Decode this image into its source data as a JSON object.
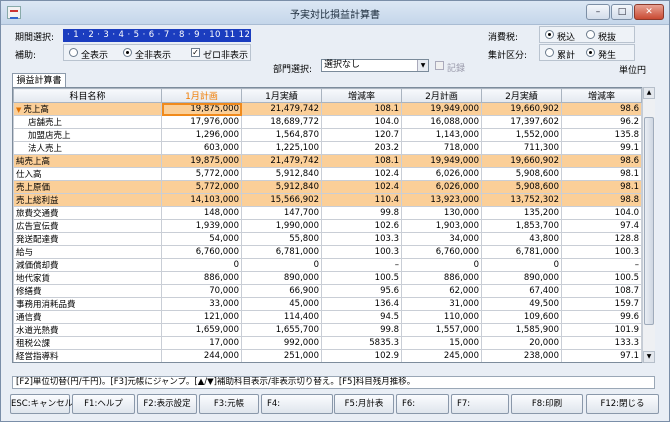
{
  "window": {
    "title": "予実対比損益計算書",
    "min": "–",
    "max": "□",
    "close": "✕",
    "icon": "app-chart-icon"
  },
  "controls": {
    "period_label": "期間選択:",
    "period_value": "· 1 · 2 · 3 · 4 · 5 · 6 · 7 · 8 · 9 · 10 11 12 決",
    "subsidiary_label": "補助:",
    "subsidiary_all": "全表示",
    "subsidiary_none": "全非表示",
    "zero_hide": "ゼロ非表示",
    "dept_label": "部門選択:",
    "dept_value": "選択なし",
    "breakdown": "記録",
    "tax_label": "消費税:",
    "tax_incl": "税込",
    "tax_excl": "税抜",
    "sum_label": "集計区分:",
    "sum_cumulative": "累計",
    "sum_occurrence": "発生",
    "unit": "単位円"
  },
  "tab": "損益計算書",
  "table": {
    "headers": [
      "科目名称",
      "1月計画",
      "1月実績",
      "増減率",
      "2月計画",
      "2月実績",
      "増減率"
    ],
    "rows": [
      {
        "name": "売上高",
        "v": [
          "19,875,000",
          "21,479,742",
          "108.1",
          "19,949,000",
          "19,660,902",
          "98.6"
        ],
        "hl": true,
        "marker": true
      },
      {
        "name": "店舗売上",
        "v": [
          "17,976,000",
          "18,689,772",
          "104.0",
          "16,088,000",
          "17,397,602",
          "96.2"
        ],
        "sub": true
      },
      {
        "name": "加盟店売上",
        "v": [
          "1,296,000",
          "1,564,870",
          "120.7",
          "1,143,000",
          "1,552,000",
          "135.8"
        ],
        "sub": true
      },
      {
        "name": "法人売上",
        "v": [
          "603,000",
          "1,225,100",
          "203.2",
          "718,000",
          "711,300",
          "99.1"
        ],
        "sub": true
      },
      {
        "name": "純売上高",
        "v": [
          "19,875,000",
          "21,479,742",
          "108.1",
          "19,949,000",
          "19,660,902",
          "98.6"
        ],
        "hl": true
      },
      {
        "name": "仕入高",
        "v": [
          "5,772,000",
          "5,912,840",
          "102.4",
          "6,026,000",
          "5,908,600",
          "98.1"
        ]
      },
      {
        "name": "売上原価",
        "v": [
          "5,772,000",
          "5,912,840",
          "102.4",
          "6,026,000",
          "5,908,600",
          "98.1"
        ],
        "hl": true
      },
      {
        "name": "売上総利益",
        "v": [
          "14,103,000",
          "15,566,902",
          "110.4",
          "13,923,000",
          "13,752,302",
          "98.8"
        ],
        "hl": true
      },
      {
        "name": "旅費交通費",
        "v": [
          "148,000",
          "147,700",
          "99.8",
          "130,000",
          "135,200",
          "104.0"
        ]
      },
      {
        "name": "広告宣伝費",
        "v": [
          "1,939,000",
          "1,990,000",
          "102.6",
          "1,903,000",
          "1,853,700",
          "97.4"
        ]
      },
      {
        "name": "発送配達費",
        "v": [
          "54,000",
          "55,800",
          "103.3",
          "34,000",
          "43,800",
          "128.8"
        ]
      },
      {
        "name": "給与",
        "v": [
          "6,760,000",
          "6,781,000",
          "100.3",
          "6,760,000",
          "6,781,000",
          "100.3"
        ]
      },
      {
        "name": "減価償却費",
        "v": [
          "0",
          "0",
          "–",
          "0",
          "0",
          "–"
        ]
      },
      {
        "name": "地代家賃",
        "v": [
          "886,000",
          "890,000",
          "100.5",
          "886,000",
          "890,000",
          "100.5"
        ]
      },
      {
        "name": "修繕費",
        "v": [
          "70,000",
          "66,900",
          "95.6",
          "62,000",
          "67,400",
          "108.7"
        ]
      },
      {
        "name": "事務用消耗品費",
        "v": [
          "33,000",
          "45,000",
          "136.4",
          "31,000",
          "49,500",
          "159.7"
        ]
      },
      {
        "name": "通信費",
        "v": [
          "121,000",
          "114,400",
          "94.5",
          "110,000",
          "109,600",
          "99.6"
        ]
      },
      {
        "name": "水道光熱費",
        "v": [
          "1,659,000",
          "1,655,700",
          "99.8",
          "1,557,000",
          "1,585,900",
          "101.9"
        ]
      },
      {
        "name": "租税公課",
        "v": [
          "17,000",
          "992,000",
          "5835.3",
          "15,000",
          "20,000",
          "133.3"
        ]
      },
      {
        "name": "経営指導料",
        "v": [
          "244,000",
          "251,000",
          "102.9",
          "245,000",
          "238,000",
          "97.1"
        ]
      }
    ]
  },
  "status": "[F2]単位切替(円/千円)。[F3]元帳にジャンプ。[▲/▼]補助科目表示/非表示切り替え。[F5]科目残月推移。",
  "fkeys": [
    {
      "label": "ESC:キャンセル"
    },
    {
      "label": "F1:ヘルプ"
    },
    {
      "label": "F2:表示設定"
    },
    {
      "label": "F3:元帳"
    },
    {
      "label": "F4:"
    },
    {
      "label": "F5:月計表"
    },
    {
      "label": "F6:"
    },
    {
      "label": "F7:"
    },
    {
      "label": "F8:印刷"
    },
    {
      "label": "F12:閉じる"
    }
  ]
}
